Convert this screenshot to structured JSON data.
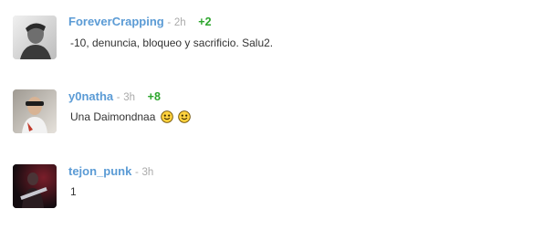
{
  "comments": [
    {
      "username": "ForeverCrapping",
      "separator": "-",
      "time": "2h",
      "votes": "+2",
      "text": "-10, denuncia, bloqueo y sacrificio. Salu2.",
      "avatar_icon": "user-avatar-photo"
    },
    {
      "username": "y0natha",
      "separator": "-",
      "time": "3h",
      "votes": "+8",
      "text": "Una Daimondnaa",
      "emoticons": [
        "smiley-icon",
        "smiley-icon"
      ],
      "avatar_icon": "user-avatar-photo"
    },
    {
      "username": "tejon_punk",
      "separator": "-",
      "time": "3h",
      "votes": "",
      "text": "1",
      "avatar_icon": "user-avatar-photo"
    }
  ],
  "colors": {
    "username": "#5b9bd5",
    "votes": "#2ca52c",
    "meta": "#aaaaaa",
    "text": "#333333"
  }
}
